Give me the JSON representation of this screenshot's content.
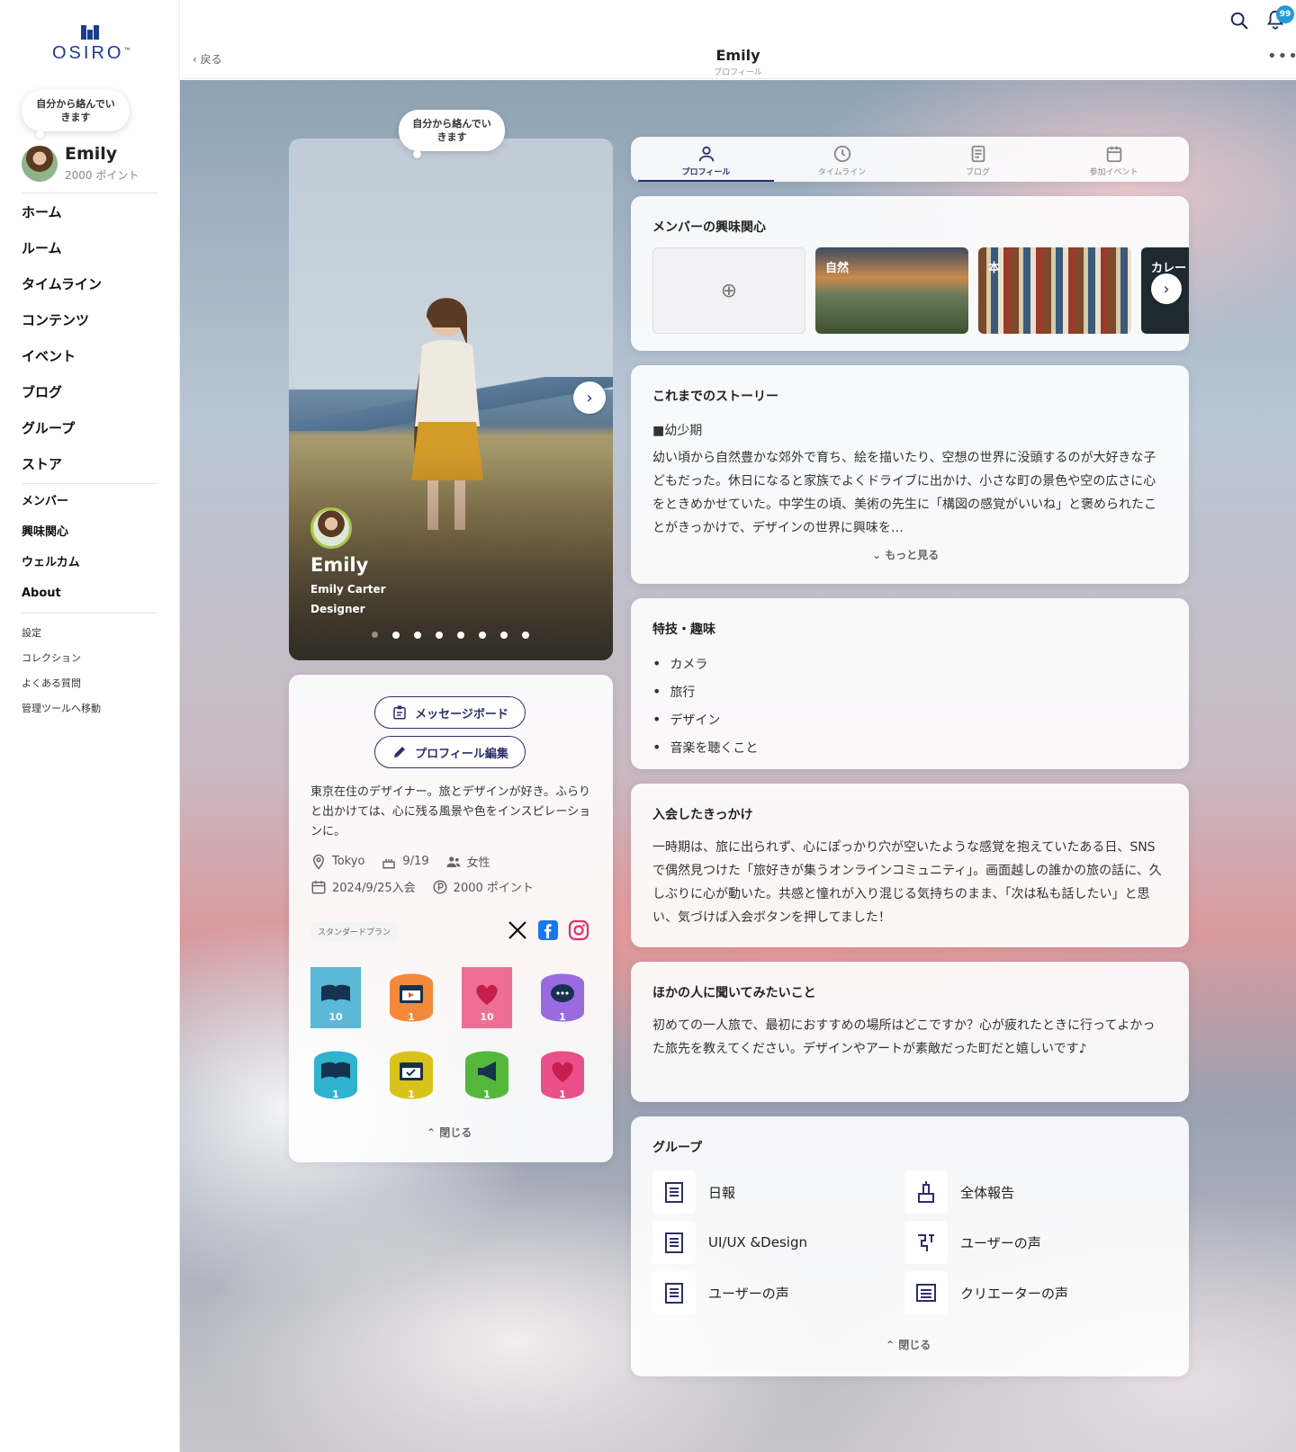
{
  "sidebar": {
    "logo_text": "OSIRO",
    "logo_tm": "™",
    "status_bubble": "自分から絡んでいきます",
    "user": {
      "name": "Emily",
      "points": "2000 ポイント"
    },
    "main_nav": [
      "ホーム",
      "ルーム",
      "タイムライン",
      "コンテンツ",
      "イベント",
      "ブログ",
      "グループ",
      "ストア"
    ],
    "sub_nav": [
      "メンバー",
      "興味関心",
      "ウェルカム",
      "About"
    ],
    "small_nav": [
      "設定",
      "コレクション",
      "よくある質問",
      "管理ツールへ移動"
    ]
  },
  "header": {
    "back_label": "戻る",
    "title": "Emily",
    "subtitle": "プロフィール",
    "notification_count": "99",
    "more_label": "•••"
  },
  "photo": {
    "bubble": "自分から絡んでいきます",
    "name": "Emily",
    "full_name": "Emily Carter",
    "role": "Designer",
    "slide_count": 8,
    "active_slide": 0
  },
  "info": {
    "message_board_label": "メッセージボード",
    "edit_profile_label": "プロフィール編集",
    "bio": "東京在住のデザイナー。旅とデザインが好き。ふらりと出かけては、心に残る風景や色をインスピレーションに。",
    "location": "Tokyo",
    "birthday": "9/19",
    "gender": "女性",
    "joined": "2024/9/25入会",
    "points": "2000 ポイント",
    "plan": "スタンダードプラン",
    "badges": [
      {
        "count": "10",
        "color": "#5bb8d6",
        "icon": "book"
      },
      {
        "count": "1",
        "color": "#f5893a",
        "icon": "calendar-play"
      },
      {
        "count": "10",
        "color": "#ee6e95",
        "icon": "heart"
      },
      {
        "count": "1",
        "color": "#9a6be0",
        "icon": "chat"
      },
      {
        "count": "1",
        "color": "#2fb3cf",
        "icon": "book"
      },
      {
        "count": "1",
        "color": "#d9c21a",
        "icon": "calendar-check"
      },
      {
        "count": "1",
        "color": "#55b83c",
        "icon": "megaphone"
      },
      {
        "count": "1",
        "color": "#e9508a",
        "icon": "heart"
      }
    ],
    "close_label": "閉じる"
  },
  "tabs": [
    {
      "label": "プロフィール",
      "active": true,
      "icon": "person-icon"
    },
    {
      "label": "タイムライン",
      "active": false,
      "icon": "clock-icon"
    },
    {
      "label": "ブログ",
      "active": false,
      "icon": "document-icon"
    },
    {
      "label": "参加イベント",
      "active": false,
      "icon": "calendar-icon"
    }
  ],
  "interests": {
    "title": "メンバーの興味関心",
    "items": [
      "自然",
      "本",
      "カレー"
    ]
  },
  "story": {
    "title": "これまでのストーリー",
    "heading": "■幼少期",
    "body": "幼い頃から自然豊かな郊外で育ち、絵を描いたり、空想の世界に没頭するのが大好きな子どもだった。休日になると家族でよくドライブに出かけ、小さな町の景色や空の広さに心をときめかせていた。中学生の頃、美術の先生に「構図の感覚がいいね」と褒められたことがきっかけで、デザインの世界に興味を…",
    "more_label": "もっと見る"
  },
  "hobbies": {
    "title": "特技・趣味",
    "items": [
      "カメラ",
      "旅行",
      "デザイン",
      "音楽を聴くこと"
    ]
  },
  "reason": {
    "title": "入会したきっかけ",
    "body": "一時期は、旅に出られず、心にぽっかり穴が空いたような感覚を抱えていたある日、SNSで偶然見つけた「旅好きが集うオンラインコミュニティ」。画面越しの誰かの旅の話に、久しぶりに心が動いた。共感と憧れが入り混じる気持ちのまま、「次は私も話したい」と思い、気づけば入会ボタンを押してました！"
  },
  "questions": {
    "title": "ほかの人に聞いてみたいこと",
    "body": "初めての一人旅で、最初におすすめの場所はどこですか？心が疲れたときに行ってよかった旅先を教えてください。デザインやアートが素敵だった町だと嬉しいです♪"
  },
  "groups": {
    "title": "グループ",
    "items": [
      "日報",
      "全体報告",
      "UI/UX &Design",
      "ユーザーの声",
      "ユーザーの声",
      "クリエーターの声"
    ],
    "close_label": "閉じる"
  },
  "colors": {
    "accent": "#2c2f6b",
    "logo": "#1d3c8f",
    "badge": "#1f9bd7"
  }
}
